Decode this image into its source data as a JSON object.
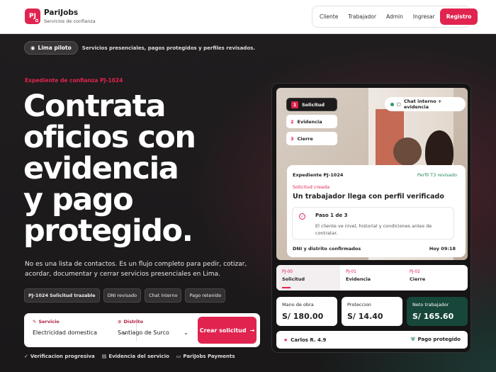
{
  "header": {
    "logo_text": "PJ",
    "brand_name": "PariJobs",
    "brand_sub": "Servicios de confianza",
    "nav": [
      "Cliente",
      "Trabajador",
      "Admin",
      "Ingresar"
    ],
    "register_label": "Registro"
  },
  "pill": {
    "label": "Lima piloto",
    "text": "Servicios presenciales, pagos protegidos y perfiles revisados."
  },
  "eyebrow": "Expediente de confianza PJ-1024",
  "hero_lines": [
    "Contrata",
    "oficios con",
    "evidencia",
    "y pago",
    "protegido."
  ],
  "lead": "No es una lista de contactos. Es un flujo completo para pedir, cotizar, acordar, documentar y cerrar servicios presenciales en Lima.",
  "tags": {
    "id": "PJ-1024",
    "first": "Solicitud trazable",
    "others": [
      "DNI revisado",
      "Chat interno",
      "Pago retenido"
    ]
  },
  "search": {
    "service_label": "Servicio",
    "service_value": "Electricidad domestica",
    "district_label": "Distrito",
    "district_value": "Santiago de Surco",
    "cta": "Crear solicitud"
  },
  "features": [
    "Verificacion progresiva",
    "Evidencia del servicio",
    "PariJobs Payments"
  ],
  "panel": {
    "steps": [
      {
        "n": "1",
        "label": "Solicitud"
      },
      {
        "n": "2",
        "label": "Evidencia"
      },
      {
        "n": "3",
        "label": "Cierre"
      }
    ],
    "chat": "Chat interno + evidencia",
    "card": {
      "id": "Expediente PJ-1024",
      "level": "Perfil T3 revisado",
      "status": "Solicitud creada",
      "title": "Un trabajador llega con perfil verificado",
      "step": "Paso 1 de 3",
      "step_desc": "El cliente ve nivel, historial y condiciones antes de contratar.",
      "footer": "DNI y distrito confirmados",
      "time": "Hoy 09:18"
    },
    "tabs": [
      {
        "code": "PJ-00",
        "label": "Solicitud"
      },
      {
        "code": "PJ-01",
        "label": "Evidencia"
      },
      {
        "code": "PJ-02",
        "label": "Cierre"
      }
    ],
    "money": [
      {
        "label": "Mano de obra",
        "value": "S/ 180.00"
      },
      {
        "label": "Proteccion",
        "value": "S/ 14.40"
      },
      {
        "label": "Neto trabajador",
        "value": "S/ 165.60"
      }
    ],
    "rating": "Carlos R. 4.9",
    "payment": "Pago protegido"
  },
  "colors": {
    "accent": "#e0244f",
    "dark_green": "#17473a",
    "bg": "#1e1b1c"
  }
}
